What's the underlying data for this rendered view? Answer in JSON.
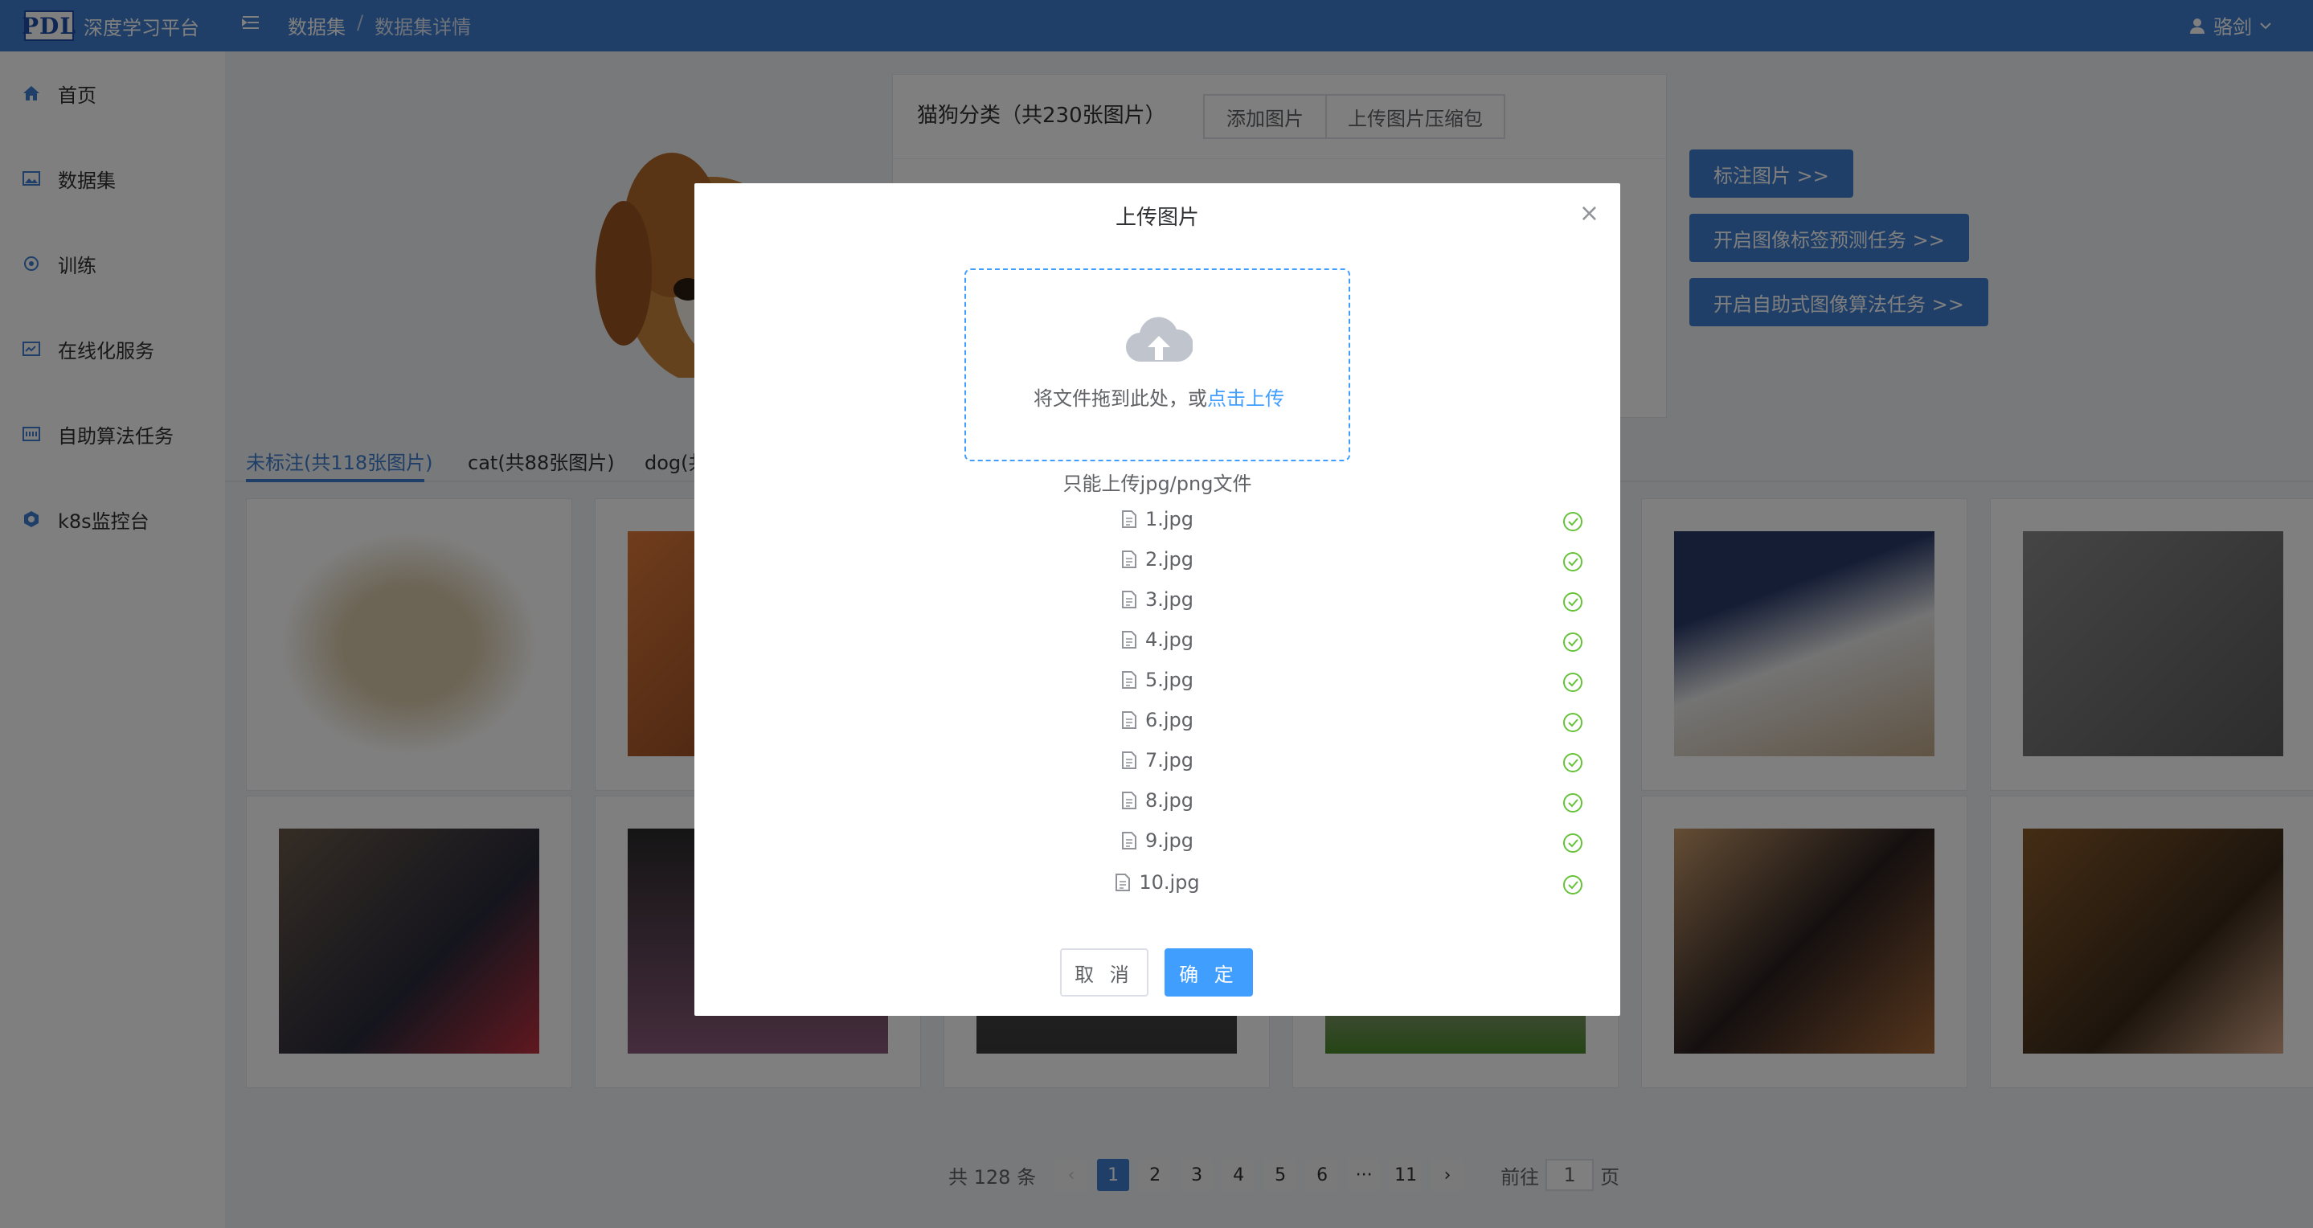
{
  "app": {
    "logo": "PDL",
    "name": "深度学习平台"
  },
  "breadcrumb": [
    "数据集",
    "数据集详情"
  ],
  "user": {
    "name": "骆剑"
  },
  "sidebar": {
    "items": [
      {
        "label": "首页",
        "icon": "home-icon"
      },
      {
        "label": "数据集",
        "icon": "image-icon"
      },
      {
        "label": "训练",
        "icon": "train-icon"
      },
      {
        "label": "在线化服务",
        "icon": "service-icon"
      },
      {
        "label": "自助算法任务",
        "icon": "algo-icon"
      },
      {
        "label": "k8s监控台",
        "icon": "k8s-icon"
      }
    ]
  },
  "dataset": {
    "title": "猫狗分类（共230张图片）",
    "add_image": "添加图片",
    "upload_zip": "上传图片压缩包"
  },
  "actions": [
    "标注图片  >>",
    "开启图像标签预测任务  >>",
    "开启自助式图像算法任务  >>"
  ],
  "tabs": [
    "未标注(共118张图片)",
    "cat(共88张图片)",
    "dog(共"
  ],
  "pagination": {
    "total": "共 128 条",
    "pages": [
      "1",
      "2",
      "3",
      "4",
      "5",
      "6",
      "···",
      "11"
    ],
    "current": "1",
    "goto_prefix": "前往",
    "goto_value": "1",
    "goto_suffix": "页"
  },
  "dialog": {
    "title": "上传图片",
    "drop_text": "将文件拖到此处，或",
    "drop_link": "点击上传",
    "tip": "只能上传jpg/png文件",
    "files": [
      "1.jpg",
      "2.jpg",
      "3.jpg",
      "4.jpg",
      "5.jpg",
      "6.jpg",
      "7.jpg",
      "8.jpg",
      "9.jpg",
      "10.jpg"
    ],
    "cancel": "取 消",
    "confirm": "确 定"
  },
  "colors": {
    "primary": "#3f7fd0",
    "dialog_primary": "#409eff",
    "success": "#67c23a"
  }
}
